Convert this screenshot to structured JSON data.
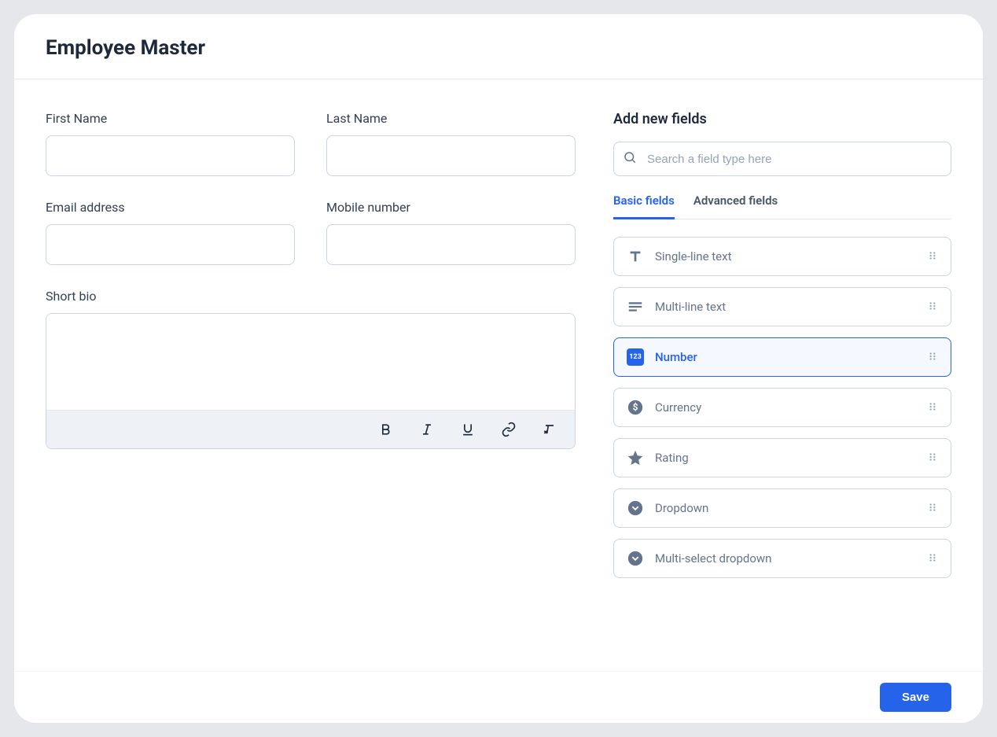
{
  "header": {
    "title": "Employee Master"
  },
  "form": {
    "fields": [
      {
        "label": "First Name",
        "value": ""
      },
      {
        "label": "Last Name",
        "value": ""
      },
      {
        "label": "Email address",
        "value": ""
      },
      {
        "label": "Mobile number",
        "value": ""
      }
    ],
    "bio": {
      "label": "Short bio",
      "value": ""
    }
  },
  "sidebar": {
    "title": "Add new fields",
    "search_placeholder": "Search a field type here",
    "tabs": [
      {
        "label": "Basic fields",
        "active": true
      },
      {
        "label": "Advanced fields",
        "active": false
      }
    ],
    "field_types": [
      {
        "label": "Single-line text",
        "icon": "text",
        "selected": false
      },
      {
        "label": "Multi-line text",
        "icon": "multiline",
        "selected": false
      },
      {
        "label": "Number",
        "icon": "number",
        "selected": true
      },
      {
        "label": "Currency",
        "icon": "currency",
        "selected": false
      },
      {
        "label": "Rating",
        "icon": "star",
        "selected": false
      },
      {
        "label": "Dropdown",
        "icon": "dropdown",
        "selected": false
      },
      {
        "label": "Multi-select dropdown",
        "icon": "dropdown",
        "selected": false
      }
    ]
  },
  "footer": {
    "save_label": "Save"
  }
}
